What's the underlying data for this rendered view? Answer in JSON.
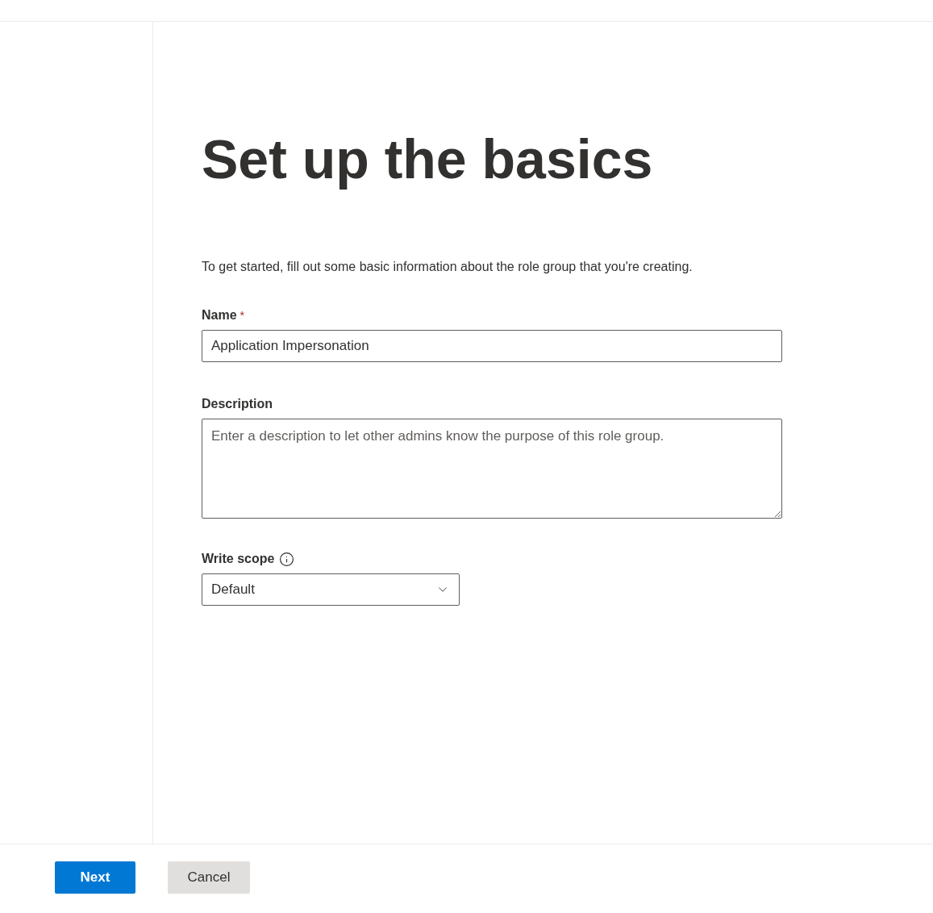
{
  "title": "Set up the basics",
  "intro": "To get started, fill out some basic information about the role group that you're creating.",
  "name_field": {
    "label": "Name",
    "required_mark": "*",
    "value": "Application Impersonation"
  },
  "description_field": {
    "label": "Description",
    "placeholder": "Enter a description to let other admins know the purpose of this role group."
  },
  "write_scope": {
    "label": "Write scope",
    "value": "Default"
  },
  "buttons": [
    {
      "label": "Next",
      "kind": "primary"
    },
    {
      "label": "Cancel",
      "kind": "secondary"
    }
  ]
}
